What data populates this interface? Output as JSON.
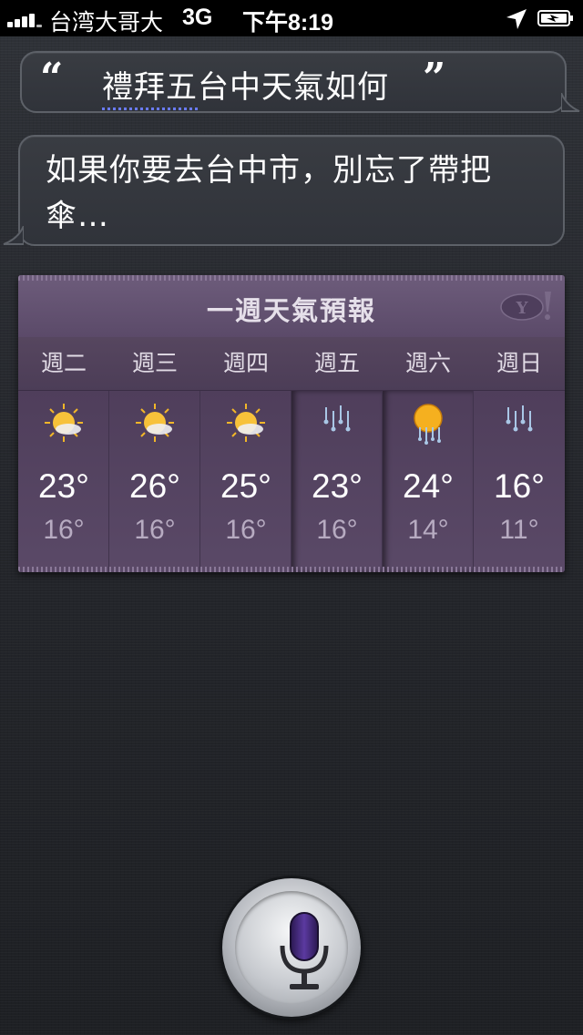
{
  "status_bar": {
    "carrier": "台湾大哥大",
    "network": "3G",
    "time": "下午8:19",
    "icons": [
      "signal-bars",
      "location-arrow",
      "battery-charging"
    ]
  },
  "conversation": {
    "open_quote": "“",
    "close_quote": "”",
    "user_query_corrected": "禮拜五",
    "user_query_rest": "台中天氣如何",
    "siri_response": "如果你要去台中市，別忘了帶把傘…"
  },
  "weather": {
    "title": "一週天氣預報",
    "provider_logo": "yahoo-logo",
    "days": [
      {
        "label": "週二",
        "icon": "partly-cloudy-icon",
        "high": "23°",
        "low": "16°"
      },
      {
        "label": "週三",
        "icon": "partly-cloudy-icon",
        "high": "26°",
        "low": "16°"
      },
      {
        "label": "週四",
        "icon": "partly-cloudy-icon",
        "high": "25°",
        "low": "16°"
      },
      {
        "label": "週五",
        "icon": "rain-icon",
        "high": "23°",
        "low": "16°"
      },
      {
        "label": "週六",
        "icon": "sun-rain-icon",
        "high": "24°",
        "low": "14°"
      },
      {
        "label": "週日",
        "icon": "rain-icon",
        "high": "16°",
        "low": "11°"
      }
    ]
  },
  "mic_button": {
    "icon": "microphone-icon"
  },
  "colors": {
    "card_purple": "#584766",
    "mic_accent": "#4a2c8a",
    "correction_underline": "#6a7bff"
  }
}
